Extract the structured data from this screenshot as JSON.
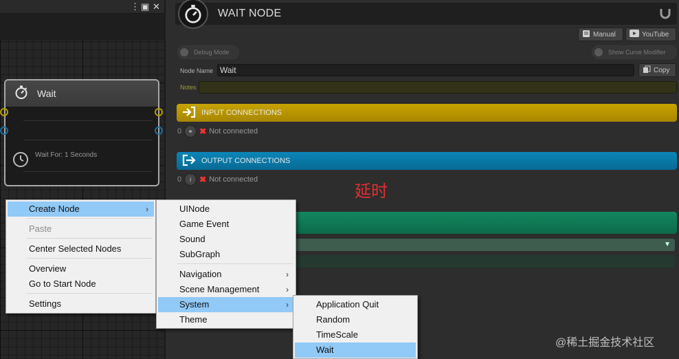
{
  "graph": {
    "node": {
      "title": "Wait",
      "wait_text": "Wait For: 1 Seconds"
    }
  },
  "inspector": {
    "title": "WAIT NODE",
    "manual_label": "Manual",
    "youtube_label": "YouTube",
    "debug_mode_label": "Debug Mode",
    "show_curve_label": "Show Curve Modifier",
    "node_name_label": "Node Name",
    "node_name_value": "Wait",
    "copy_label": "Copy",
    "notes_label": "Notes",
    "notes_value": "",
    "input_header": "INPUT CONNECTIONS",
    "input_count": "0",
    "input_status": "Not connected",
    "output_header": "OUTPUT CONNECTIONS",
    "output_count": "0",
    "output_status": "Not connected"
  },
  "annotation": "延时",
  "watermark": "@稀土掘金技术社区",
  "context_menu": {
    "items": [
      {
        "label": "Create Node",
        "state": "selected",
        "submenu": true
      },
      {
        "label": "Paste",
        "state": "disabled"
      },
      {
        "label": "Center Selected Nodes"
      },
      {
        "label": "Overview"
      },
      {
        "label": "Go to Start Node"
      },
      {
        "label": "Settings"
      }
    ]
  },
  "create_node_menu": {
    "items": [
      {
        "label": "UINode"
      },
      {
        "label": "Game Event"
      },
      {
        "label": "Sound"
      },
      {
        "label": "SubGraph"
      },
      {
        "label": "Navigation",
        "submenu": true
      },
      {
        "label": "Scene Management",
        "submenu": true
      },
      {
        "label": "System",
        "state": "selected",
        "submenu": true
      },
      {
        "label": "Theme"
      }
    ]
  },
  "system_menu": {
    "items": [
      {
        "label": "Application Quit"
      },
      {
        "label": "Random"
      },
      {
        "label": "TimeScale"
      },
      {
        "label": "Wait",
        "state": "selected"
      }
    ]
  },
  "colors": {
    "input_bar": "#b89400",
    "output_bar": "#0a7fb0",
    "green_bar": "#0f7a55",
    "menu_highlight": "#91c9f7"
  }
}
